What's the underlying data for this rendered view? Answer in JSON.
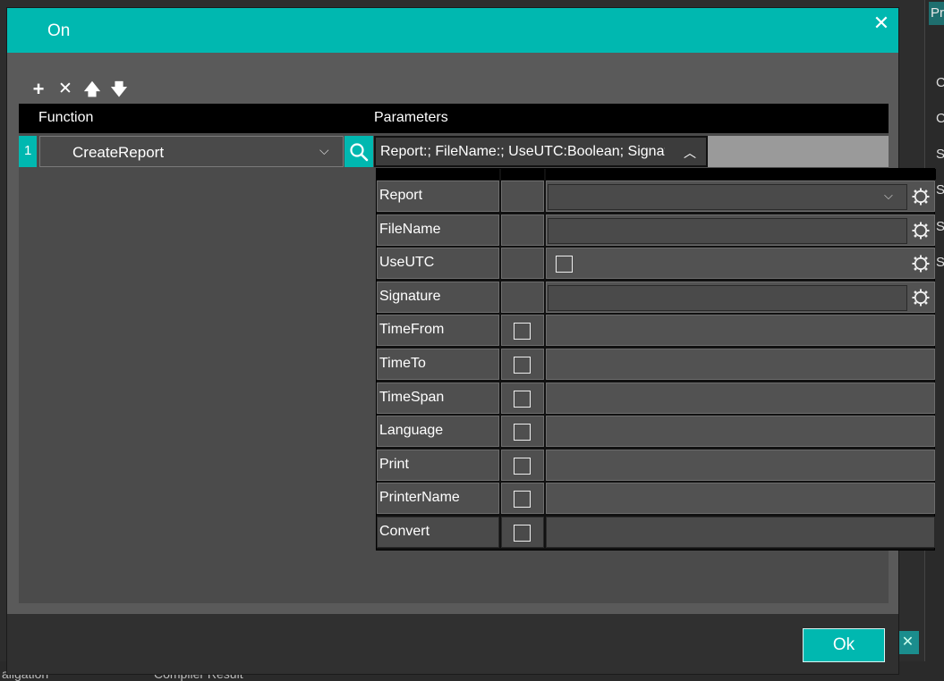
{
  "background": {
    "right_tab": "Pr",
    "right_letters": [
      "C",
      "C",
      "S",
      "S",
      "S",
      "S"
    ],
    "bottom_tabs": [
      "aligation",
      "Compiler Result"
    ],
    "close_glyph": "✕"
  },
  "dialog": {
    "title": "On",
    "close_glyph": "✕",
    "toolbar": {
      "add": "+",
      "remove": "✕",
      "up": "🡅",
      "down": "🡇"
    },
    "grid": {
      "header_function": "Function",
      "header_parameters": "Parameters",
      "row": {
        "index": "1",
        "function": "CreateReport",
        "function_chevron": "⌵",
        "parameters": "Report:; FileName:; UseUTC:Boolean; Signature:; TimeFrom:; TimeTo:",
        "parameters_chevron": "︿"
      }
    },
    "parameters": [
      {
        "name": "Report",
        "has_checkbox": false,
        "editor": "dropdown",
        "dd_glyph": "⌵"
      },
      {
        "name": "FileName",
        "has_checkbox": false,
        "editor": "text"
      },
      {
        "name": "UseUTC",
        "has_checkbox": false,
        "editor": "checkbox"
      },
      {
        "name": "Signature",
        "has_checkbox": false,
        "editor": "text"
      },
      {
        "name": "TimeFrom",
        "has_checkbox": true,
        "editor": "none"
      },
      {
        "name": "TimeTo",
        "has_checkbox": true,
        "editor": "none"
      },
      {
        "name": "TimeSpan",
        "has_checkbox": true,
        "editor": "none"
      },
      {
        "name": "Language",
        "has_checkbox": true,
        "editor": "none"
      },
      {
        "name": "Print",
        "has_checkbox": true,
        "editor": "none"
      },
      {
        "name": "PrinterName",
        "has_checkbox": true,
        "editor": "none"
      },
      {
        "name": "Convert",
        "has_checkbox": true,
        "editor": "none"
      }
    ],
    "ok_label": "Ok"
  },
  "colors": {
    "accent": "#00b8b0",
    "panel": "#5a5a5a",
    "grid": "#4b4b4b"
  }
}
